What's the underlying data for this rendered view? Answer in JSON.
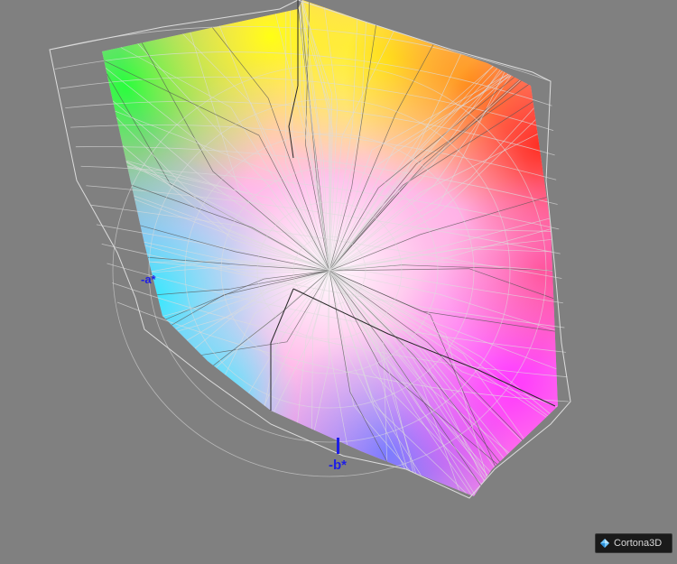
{
  "axes": {
    "a_label": "-a*",
    "b_label": "-b*",
    "axis_color": "#1e1ee6"
  },
  "gamut": {
    "corner_colors": {
      "green": "#28ff3c",
      "yellow": "#ffff14",
      "orange": "#ff9a1e",
      "red": "#ff2e22",
      "cyan": "#14e6ff",
      "blue": "#6e6eff",
      "magenta": "#ff32ff",
      "white": "#ffffff"
    },
    "wireframe_color": "#dcdcdc"
  },
  "background_color": "#808080",
  "badge": {
    "text": "Cortona3D",
    "icon": "cortona-logo-icon"
  }
}
